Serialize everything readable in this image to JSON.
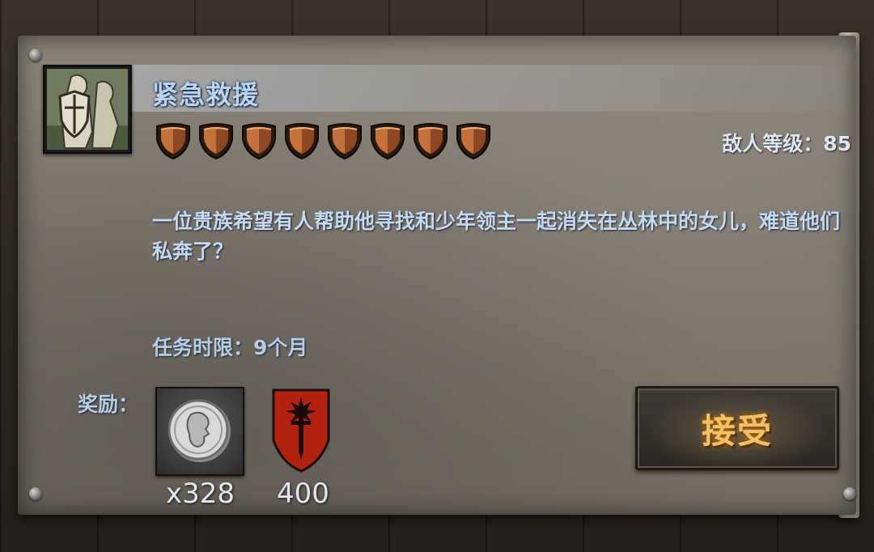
{
  "quest": {
    "title": "紧急救援",
    "difficulty_stars": 8,
    "enemy_level_text": "敌人等级：85",
    "description": "一位贵族希望有人帮助他寻找和少年领主一起消失在丛林中的女儿，难道他们私奔了？",
    "time_limit_text": "任务时限：9个月"
  },
  "rewards": {
    "label": "奖励：",
    "items": [
      {
        "icon": "silver-coin-icon",
        "quantity": "x328"
      },
      {
        "icon": "red-sword-banner-icon",
        "quantity": "400"
      }
    ]
  },
  "actions": {
    "accept_label": "接受"
  },
  "colors": {
    "title": "#b9d4f2",
    "text": "#c5daf0",
    "accept": "#f2c066",
    "banner_red": "#b3210f"
  }
}
